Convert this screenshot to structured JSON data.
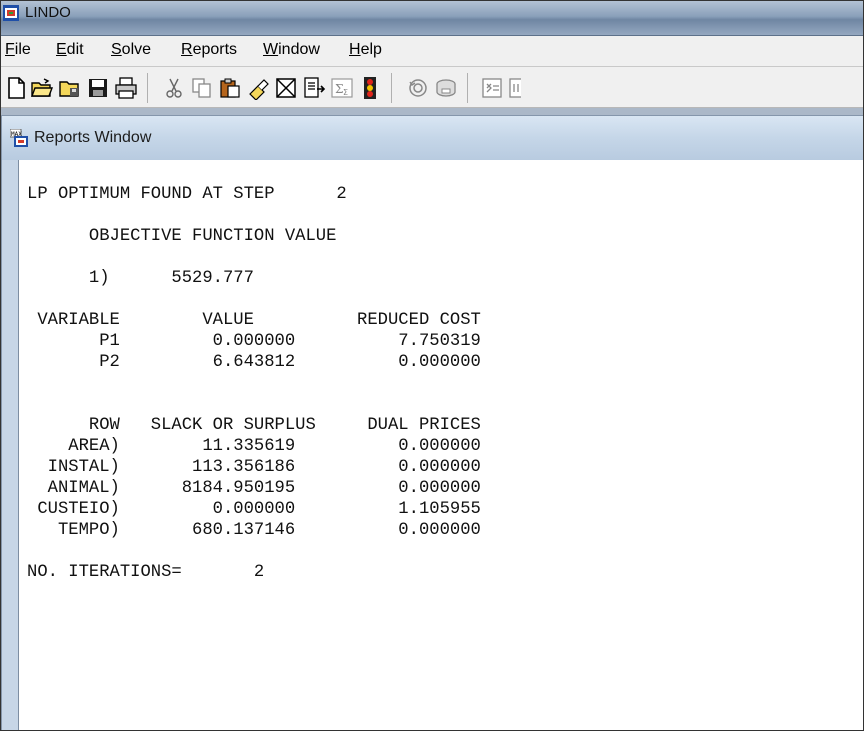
{
  "window": {
    "title": "LINDO"
  },
  "menu": [
    {
      "label": "File",
      "mnemonic": "F",
      "rest": "ile"
    },
    {
      "label": "Edit",
      "mnemonic": "E",
      "rest": "dit"
    },
    {
      "label": "Solve",
      "mnemonic": "S",
      "rest": "olve"
    },
    {
      "label": "Reports",
      "mnemonic": "R",
      "rest": "eports"
    },
    {
      "label": "Window",
      "mnemonic": "W",
      "rest": "indow"
    },
    {
      "label": "Help",
      "mnemonic": "H",
      "rest": "elp"
    }
  ],
  "toolbar": {
    "icons": [
      "new-file-icon",
      "open-file-icon",
      "open-folder-icon",
      "save-icon",
      "print-icon",
      "cut-icon",
      "copy-icon",
      "paste-icon",
      "find-icon",
      "close-box-icon",
      "export-icon",
      "sum-icon",
      "traffic-light-icon",
      "rotate-icon",
      "disk-icon",
      "matrix-icon"
    ]
  },
  "child_window": {
    "title": "Reports Window"
  },
  "report": {
    "lines": [
      "LP OPTIMUM FOUND AT STEP      2",
      "",
      "      OBJECTIVE FUNCTION VALUE",
      "",
      "      1)      5529.777",
      "",
      " VARIABLE        VALUE          REDUCED COST",
      "       P1         0.000000          7.750319",
      "       P2         6.643812          0.000000",
      "",
      "",
      "      ROW   SLACK OR SURPLUS     DUAL PRICES",
      "    AREA)        11.335619          0.000000",
      "  INSTAL)       113.356186          0.000000",
      "  ANIMAL)      8184.950195          0.000000",
      " CUSTEIO)         0.000000          1.105955",
      "   TEMPO)       680.137146          0.000000",
      "",
      "NO. ITERATIONS=       2"
    ]
  },
  "colors": {
    "titlebar": "#8aa0ba",
    "child_titlebar": "#c5d6e8",
    "mdi_background": "#abb8c8",
    "report_background": "#ffffff",
    "text": "#111111"
  }
}
